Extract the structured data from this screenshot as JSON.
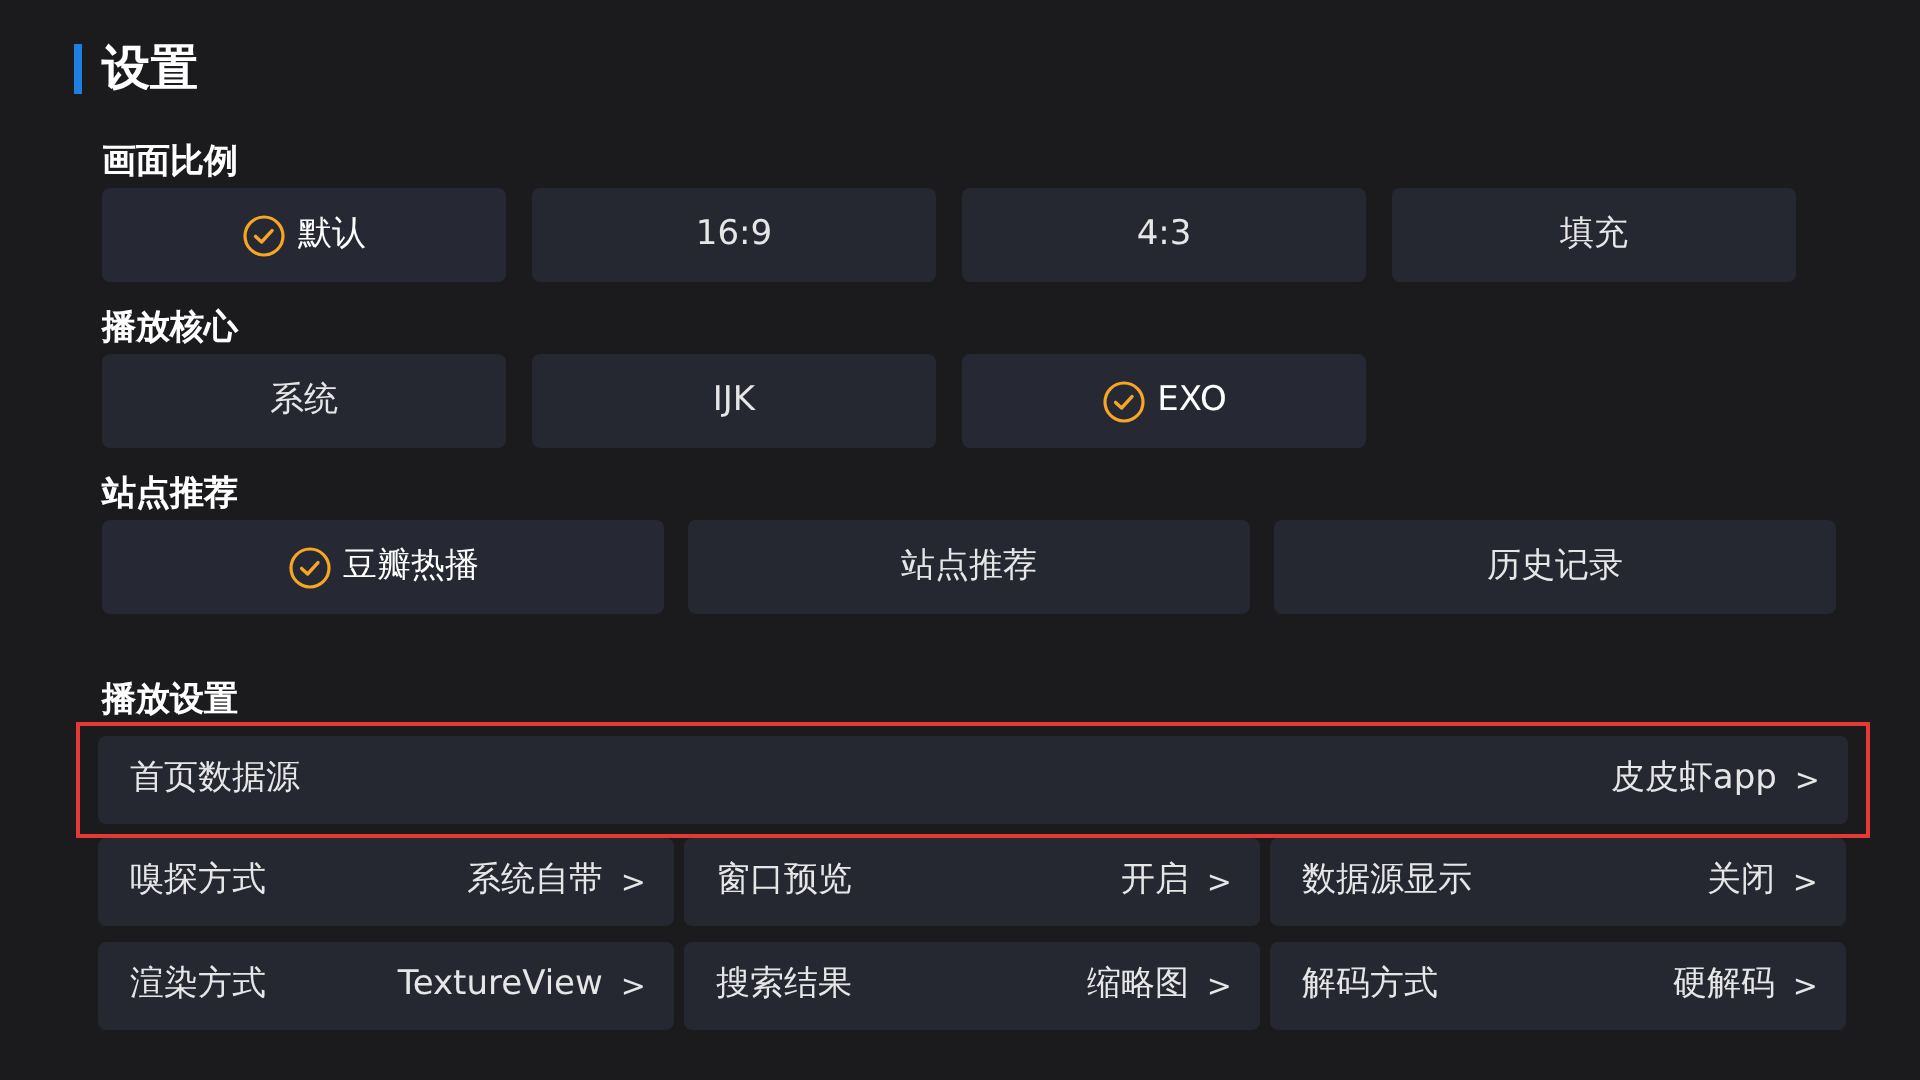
{
  "title": "设置",
  "sections": [
    {
      "label": "画面比例",
      "kind": "compact",
      "options": [
        {
          "label": "默认",
          "selected": true
        },
        {
          "label": "16:9",
          "selected": false
        },
        {
          "label": "4:3",
          "selected": false
        },
        {
          "label": "填充",
          "selected": false
        }
      ]
    },
    {
      "label": "播放核心",
      "kind": "compact",
      "options": [
        {
          "label": "系统",
          "selected": false
        },
        {
          "label": "IJK",
          "selected": false
        },
        {
          "label": "EXO",
          "selected": true
        }
      ]
    },
    {
      "label": "站点推荐",
      "kind": "wide",
      "options": [
        {
          "label": "豆瓣热播",
          "selected": true
        },
        {
          "label": "站点推荐",
          "selected": false
        },
        {
          "label": "历史记录",
          "selected": false
        }
      ]
    }
  ],
  "playback": {
    "label": "播放设置",
    "featured": {
      "label": "首页数据源",
      "value": "皮皮虾app",
      "chevron": ">",
      "highlighted": true
    },
    "items": [
      {
        "label": "嗅探方式",
        "value": "系统自带",
        "chevron": ">"
      },
      {
        "label": "窗口预览",
        "value": "开启",
        "chevron": ">"
      },
      {
        "label": "数据源显示",
        "value": "关闭",
        "chevron": ">"
      },
      {
        "label": "渲染方式",
        "value": "TextureView",
        "chevron": ">"
      },
      {
        "label": "搜索结果",
        "value": "缩略图",
        "chevron": ">"
      },
      {
        "label": "解码方式",
        "value": "硬解码",
        "chevron": ">"
      }
    ]
  }
}
